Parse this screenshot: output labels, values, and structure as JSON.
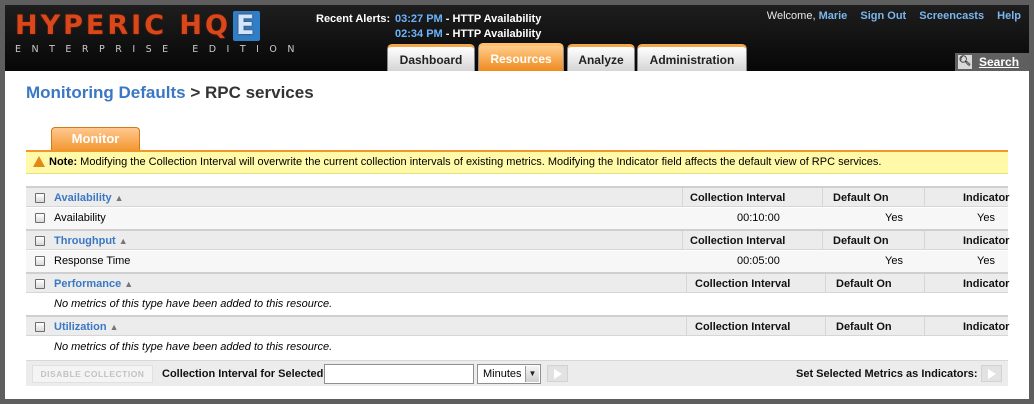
{
  "header": {
    "logo_main": "HYPERIC HQ",
    "logo_mark": "E",
    "logo_sub": "ENTERPRISE EDITION",
    "alerts_label": "Recent Alerts:",
    "alerts": [
      {
        "time": "03:27 PM",
        "name": " - HTTP Availability"
      },
      {
        "time": "02:34 PM",
        "name": " - HTTP Availability"
      }
    ],
    "welcome": "Welcome,",
    "user": "Marie",
    "links": [
      "Sign Out",
      "Screencasts",
      "Help"
    ],
    "tabs": [
      "Dashboard",
      "Resources",
      "Analyze",
      "Administration"
    ],
    "active_tab": "Resources",
    "search_label": "Search",
    "search_icon": "magnifier-icon"
  },
  "title": {
    "crumb": "Monitoring Defaults",
    "separator": " > ",
    "current": "RPC services"
  },
  "monitor_tab": "Monitor",
  "note": {
    "label": "Note:",
    "text": " Modifying the Collection Interval will overwrite the current collection intervals of existing metrics. Modifying the Indicator field affects the default view of RPC services."
  },
  "columns": {
    "interval": "Collection Interval",
    "default_on": "Default On",
    "indicator": "Indicator"
  },
  "groups": [
    {
      "name": "Availability",
      "metrics": [
        {
          "name": "Availability",
          "interval": "00:10:00",
          "default_on": "Yes",
          "indicator": "Yes"
        }
      ]
    },
    {
      "name": "Throughput",
      "metrics": [
        {
          "name": "Response Time",
          "interval": "00:05:00",
          "default_on": "Yes",
          "indicator": "Yes"
        }
      ]
    },
    {
      "name": "Performance",
      "empty_text": "No metrics of this type have been added to this resource."
    },
    {
      "name": "Utilization",
      "empty_text": "No metrics of this type have been added to this resource."
    }
  ],
  "sort_glyph": "▲",
  "footer": {
    "disable_label": "DISABLE COLLECTION",
    "interval_label": "Collection Interval for Selected:",
    "interval_value": "",
    "unit": "Minutes",
    "indicators_label": "Set Selected Metrics as Indicators:"
  },
  "colors": {
    "accent_orange": "#f2962e",
    "link_blue": "#3a78c3",
    "note_bg": "#fff9a8"
  }
}
